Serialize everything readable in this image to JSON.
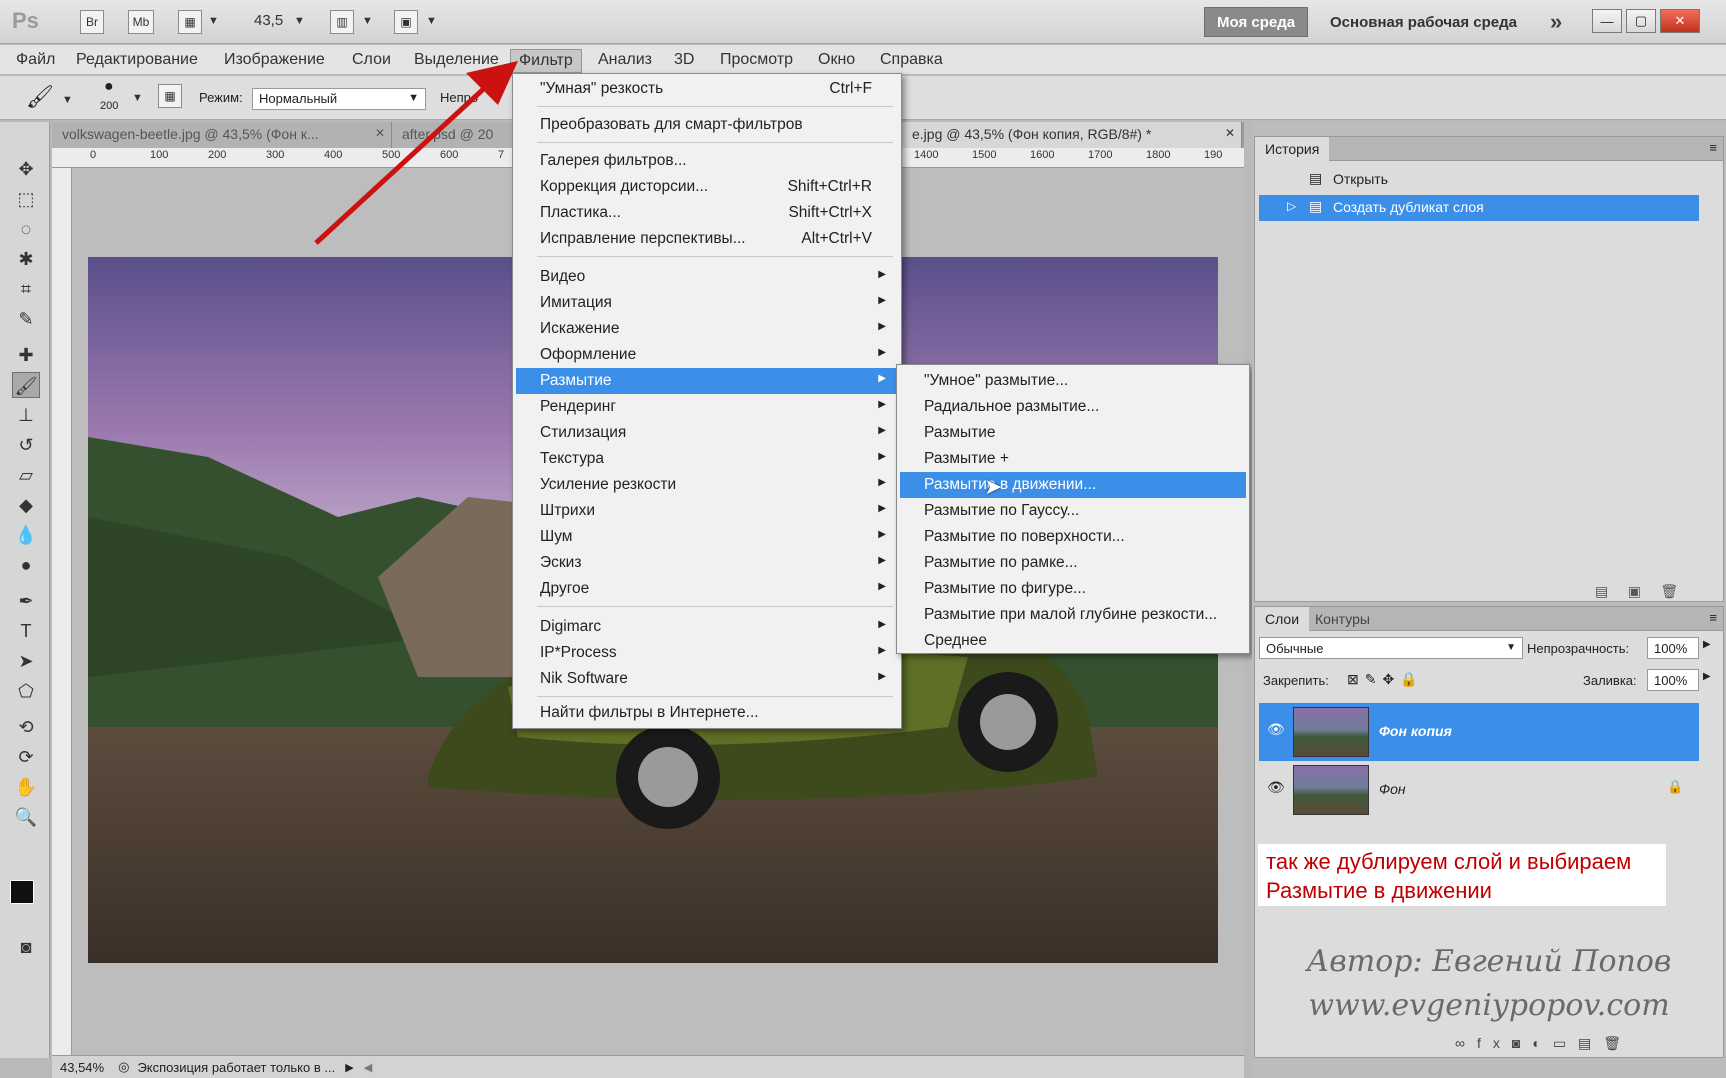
{
  "app": {
    "logo": "Ps",
    "bridge_label": "Br",
    "minibridge_label": "Mb",
    "zoom": "43,5",
    "workspace_mine": "Моя среда",
    "workspace_main": "Основная рабочая среда",
    "workspace_more": "»",
    "win_min": "—",
    "win_max": "▢",
    "win_close": "✕"
  },
  "menu": {
    "items": [
      "Файл",
      "Редактирование",
      "Изображение",
      "Слои",
      "Выделение",
      "Фильтр",
      "Анализ",
      "3D",
      "Просмотр",
      "Окно",
      "Справка"
    ]
  },
  "options": {
    "brush_size": "200",
    "mode_label": "Режим:",
    "mode_value": "Нормальный",
    "opacity_label_partial": "Непро"
  },
  "tabs": [
    {
      "label": "volkswagen-beetle.jpg @ 43,5% (Фон к...",
      "close": "✕"
    },
    {
      "label": "after.psd @ 20",
      "close": "✕"
    },
    {
      "label": "e.jpg @ 43,5% (Фон копия, RGB/8#) *",
      "close": "✕"
    }
  ],
  "ruler_left": [
    "0",
    "100",
    "200",
    "300",
    "400",
    "500",
    "600",
    "7"
  ],
  "ruler_right": [
    "1400",
    "1500",
    "1600",
    "1700",
    "1800",
    "190"
  ],
  "filter_menu": {
    "smart_sharpen": "\"Умная\" резкость",
    "smart_sharpen_shortcut": "Ctrl+F",
    "convert_smart": "Преобразовать для смарт-фильтров",
    "gallery": "Галерея фильтров...",
    "lens_correction": "Коррекция дисторсии...",
    "lens_correction_shortcut": "Shift+Ctrl+R",
    "liquify": "Пластика...",
    "liquify_shortcut": "Shift+Ctrl+X",
    "vanishing": "Исправление перспективы...",
    "vanishing_shortcut": "Alt+Ctrl+V",
    "groups": [
      "Видео",
      "Имитация",
      "Искажение",
      "Оформление",
      "Размытие",
      "Рендеринг",
      "Стилизация",
      "Текстура",
      "Усиление резкости",
      "Штрихи",
      "Шум",
      "Эскиз",
      "Другое"
    ],
    "plugins": [
      "Digimarc",
      "IP*Process",
      "Nik Software"
    ],
    "browse": "Найти фильтры в Интернете..."
  },
  "blur_submenu": [
    "\"Умное\" размытие...",
    "Радиальное размытие...",
    "Размытие",
    "Размытие +",
    "Размытие в движении...",
    "Размытие по Гауссу...",
    "Размытие по поверхности...",
    "Размытие по рамке...",
    "Размытие по фигуре...",
    "Размытие при малой глубине резкости...",
    "Среднее"
  ],
  "history": {
    "tab": "История",
    "rows": [
      "Открыть",
      "Создать дубликат слоя"
    ]
  },
  "layers": {
    "tab_layers": "Слои",
    "tab_paths": "Контуры",
    "blend_mode": "Обычные",
    "opacity_label": "Непрозрачность:",
    "opacity_value": "100%",
    "lock_label": "Закрепить:",
    "fill_label": "Заливка:",
    "fill_value": "100%",
    "rows": [
      "Фон копия",
      "Фон"
    ]
  },
  "status": {
    "zoom": "43,54%",
    "text": "Экспозиция работает только в ..."
  },
  "caption": {
    "line1": "так же дублируем слой и выбираем",
    "line2": "Размытие в движении"
  },
  "author": {
    "line1": "Автор: Евгений Попов",
    "line2": "www.evgeniypopov.com"
  }
}
